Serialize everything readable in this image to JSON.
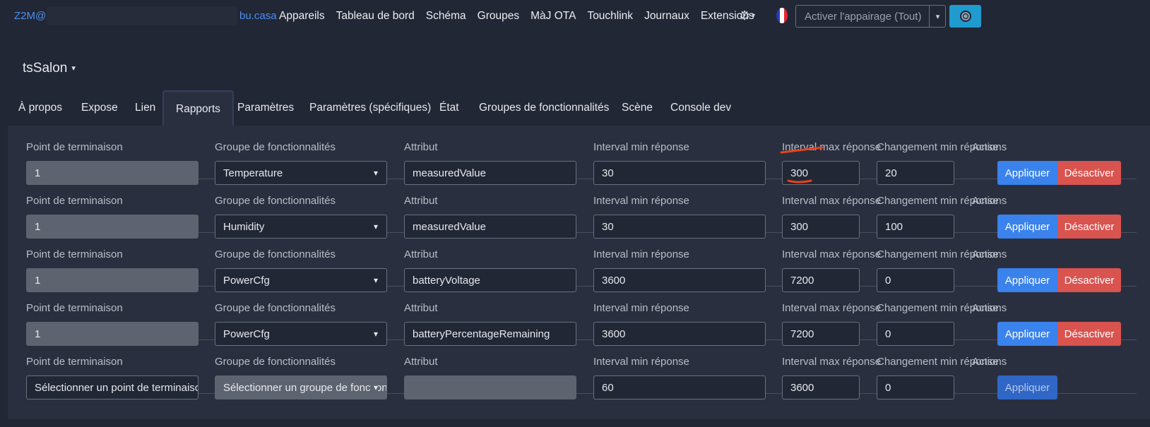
{
  "navbar": {
    "brand": "Z2M@",
    "brand_suffix": "bu.casa",
    "links": [
      "Appareils",
      "Tableau de bord",
      "Schéma",
      "Groupes",
      "MàJ OTA",
      "Touchlink",
      "Journaux",
      "Extensions"
    ],
    "settings_icon": "gear-icon",
    "language_flag": "france-flag-icon",
    "permit_join": "Activer l'appairage (Tout)",
    "network_icon": "network-icon",
    "colors": {
      "brand": "#4a8ff0",
      "network_button": "#1f9bcf"
    }
  },
  "device": {
    "name": "tsSalon"
  },
  "tabs": [
    "À propos",
    "Expose",
    "Lien",
    "Rapports",
    "Paramètres",
    "Paramètres (spécifiques)",
    "État",
    "Groupes de fonctionnalités",
    "Scène",
    "Console dev"
  ],
  "active_tab": "Rapports",
  "labels": {
    "endpoint": "Point de terminaison",
    "cluster": "Groupe de fonctionnalités",
    "attribute": "Attribut",
    "min_interval": "Interval min réponse",
    "max_interval": "Interval max réponse",
    "min_change": "Changement min réponse",
    "actions": "Actions",
    "apply": "Appliquer",
    "disable": "Désactiver"
  },
  "reports": [
    {
      "endpoint": "1",
      "cluster": "Temperature",
      "attribute": "measuredValue",
      "min_interval": "30",
      "max_interval": "300",
      "min_change": "20"
    },
    {
      "endpoint": "1",
      "cluster": "Humidity",
      "attribute": "measuredValue",
      "min_interval": "30",
      "max_interval": "300",
      "min_change": "100"
    },
    {
      "endpoint": "1",
      "cluster": "PowerCfg",
      "attribute": "batteryVoltage",
      "min_interval": "3600",
      "max_interval": "7200",
      "min_change": "0"
    },
    {
      "endpoint": "1",
      "cluster": "PowerCfg",
      "attribute": "batteryPercentageRemaining",
      "min_interval": "3600",
      "max_interval": "7200",
      "min_change": "0"
    }
  ],
  "new_report": {
    "endpoint_placeholder": "Sélectionner un point de terminaison",
    "cluster_placeholder": "Sélectionner un groupe de fonctionnalités",
    "attribute": "",
    "min_interval": "60",
    "max_interval": "3600",
    "min_change": "0"
  },
  "colors": {
    "apply": "#3a82ec",
    "disable": "#d9534f",
    "annotation": "#e8431a"
  }
}
